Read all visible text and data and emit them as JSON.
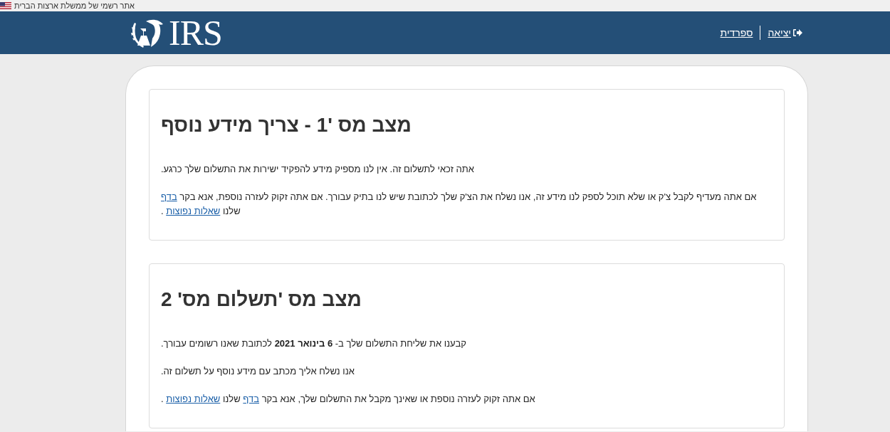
{
  "gov_banner": {
    "text": "אתר רשמי של ממשלת ארצות הברית"
  },
  "header": {
    "logo_text": "IRS",
    "nav": [
      {
        "kind": "logout",
        "label": "יציאה"
      },
      {
        "kind": "language",
        "label": "ספרדית"
      }
    ]
  },
  "cards": [
    {
      "title": "מצב מס '1 - צריך מידע נוסף",
      "paragraphs": [
        [
          {
            "kind": "text",
            "text": "אתה זכאי לתשלום זה. אין לנו מספיק מידע להפקיד ישירות את התשלום שלך כרגע."
          }
        ],
        [
          {
            "kind": "text",
            "text": "אם אתה מעדיף לקבל צ'ק או שלא תוכל לספק לנו מידע זה, אנו נשלח את הצ'ק שלך לכתובת שיש לנו בתיק עבורך. אם אתה זקוק לעזרה נוספת, אנא בקר "
          },
          {
            "kind": "link",
            "text": "בדף"
          },
          {
            "kind": "text",
            "text": " שלנו "
          },
          {
            "kind": "link",
            "text": "שאלות נפוצות"
          },
          {
            "kind": "text",
            "text": " ."
          }
        ]
      ]
    },
    {
      "title": "מצב מס 'תשלום מס' 2",
      "paragraphs": [
        [
          {
            "kind": "text",
            "text": "קבענו את שליחת התשלום שלך ב- **6 בינואר 2021** לכתובת שאנו רשומים עבורך."
          }
        ],
        [
          {
            "kind": "text",
            "text": "אנו נשלח אליך מכתב עם מידע נוסף על תשלום זה."
          }
        ],
        [
          {
            "kind": "text",
            "text": "אם אתה זקוק לעזרה נוספת או שאינך מקבל את התשלום שלך, אנא בקר "
          },
          {
            "kind": "link",
            "text": "בדף"
          },
          {
            "kind": "text",
            "text": " שלנו "
          },
          {
            "kind": "link",
            "text": "שאלות נפוצות"
          },
          {
            "kind": "text",
            "text": " ."
          }
        ]
      ]
    }
  ]
}
